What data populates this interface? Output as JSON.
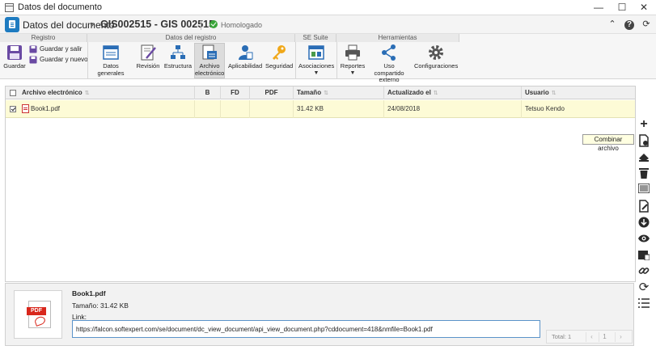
{
  "window": {
    "title": "Datos del documento"
  },
  "header": {
    "crumb": "Datos del documento",
    "doc_code": "GIS002515 - GIS 002515",
    "status": "Homologado"
  },
  "ribbon": {
    "groups": [
      "Registro",
      "Datos del registro",
      "SE Suite",
      "Herramientas"
    ],
    "registro": {
      "save": "Guardar",
      "save_exit": "Guardar y salir",
      "save_new": "Guardar y nuevo"
    },
    "datos": {
      "general": "Datos generales",
      "revision": "Revisión",
      "structure": "Estructura",
      "electronic_file_1": "Archivo",
      "electronic_file_2": "electrónico",
      "applicability": "Aplicabilidad",
      "security": "Seguridad"
    },
    "suite": {
      "associations": "Asociaciones"
    },
    "tools": {
      "reports": "Reportes",
      "ext_share_1": "Uso compartido",
      "ext_share_2": "externo",
      "settings": "Configuraciones"
    }
  },
  "grid": {
    "columns": [
      "Archivo electrónico",
      "B",
      "FD",
      "PDF",
      "Tamaño",
      "Actualizado el",
      "Usuario"
    ],
    "rows": [
      {
        "file": "Book1.pdf",
        "b": "",
        "fd": "",
        "pdf": "",
        "size": "31.42 KB",
        "updated": "24/08/2018",
        "user": "Tetsuo Kendo"
      }
    ]
  },
  "tooltip": "Combinar archivo",
  "details": {
    "name": "Book1.pdf",
    "size": "Tamaño: 31.42 KB",
    "link_label": "Link:",
    "link_value": "https://falcon.softexpert.com/se/document/dc_view_document/api_view_document.php?cddocument=418&nmfile=Book1.pdf",
    "thumb_label": "PDF"
  },
  "pager": {
    "total": "Total: 1",
    "page": "1"
  },
  "icons": [
    "save-icon",
    "save-exit-icon",
    "save-new-icon",
    "general-data-icon",
    "revision-icon",
    "structure-icon",
    "electronic-file-icon",
    "applicability-icon",
    "security-icon",
    "associations-icon",
    "reports-icon",
    "share-icon",
    "settings-icon",
    "add-icon",
    "merge-file-icon",
    "scan-icon",
    "delete-icon",
    "barcode-icon",
    "edit-file-icon",
    "download-icon",
    "view-icon",
    "checkout-icon",
    "link-icon",
    "refresh-icon",
    "list-icon"
  ]
}
